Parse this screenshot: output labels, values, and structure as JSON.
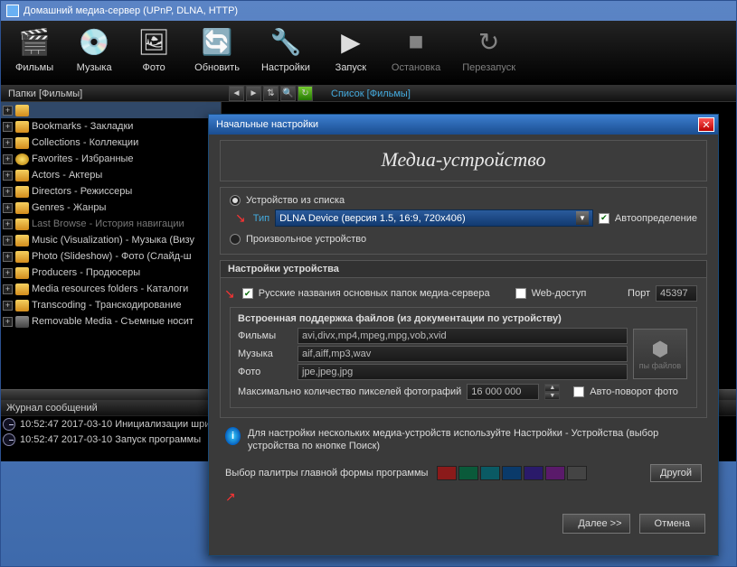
{
  "window": {
    "title": "Домашний медиа-сервер (UPnP, DLNA, HTTP)"
  },
  "toolbar": [
    {
      "label": "Фильмы",
      "glyph": "🎬"
    },
    {
      "label": "Музыка",
      "glyph": "💿"
    },
    {
      "label": "Фото",
      "glyph": "🖼"
    },
    {
      "label": "Обновить",
      "glyph": "🔄"
    },
    {
      "label": "Настройки",
      "glyph": "🔧"
    },
    {
      "label": "Запуск",
      "glyph": "▶"
    },
    {
      "label": "Остановка",
      "glyph": "■"
    },
    {
      "label": "Перезапуск",
      "glyph": "↻"
    }
  ],
  "header": {
    "folders": "Папки [Фильмы]",
    "list": "Список [Фильмы]"
  },
  "tree": [
    {
      "label": "",
      "sel": true
    },
    {
      "label": "Bookmarks - Закладки"
    },
    {
      "label": "Collections - Коллекции"
    },
    {
      "label": "Favorites - Избранные",
      "star": true
    },
    {
      "label": "Actors - Актеры"
    },
    {
      "label": "Directors - Режиссеры"
    },
    {
      "label": "Genres - Жанры"
    },
    {
      "label": "Last Browse - История навигации",
      "dim": true
    },
    {
      "label": "Music (Visualization) - Музыка (Визу"
    },
    {
      "label": "Photo (Slideshow) - Фото (Слайд-ш"
    },
    {
      "label": "Producers - Продюсеры"
    },
    {
      "label": "Media resources folders - Каталоги"
    },
    {
      "label": "Transcoding - Транскодирование"
    },
    {
      "label": "Removable Media - Съемные носит",
      "grey": true
    }
  ],
  "log": {
    "title": "Журнал сообщений",
    "rows": [
      "10:52:47 2017-03-10 Инициализации шри",
      "10:52:47 2017-03-10 Запуск программы"
    ]
  },
  "dlg": {
    "title": "Начальные настройки",
    "heading": "Медиа-устройство",
    "group1": {
      "opt1": "Устройство из списка",
      "typeLabel": "Тип",
      "typeValue": "DLNA Device (версия 1.5, 16:9, 720x406)",
      "autodetect": "Автоопределение",
      "opt2": "Произвольное устройство"
    },
    "group2": {
      "title": "Настройки устройства",
      "ruNames": "Русские названия основных папок медиа-сервера",
      "web": "Web-доступ",
      "portLabel": "Порт",
      "port": "45397",
      "filesup": {
        "title": "Встроенная поддержка файлов (из документации по устройству)",
        "movies": {
          "label": "Фильмы",
          "value": "avi,divx,mp4,mpeg,mpg,vob,xvid"
        },
        "music": {
          "label": "Музыка",
          "value": "aif,aiff,mp3,wav"
        },
        "photo": {
          "label": "Фото",
          "value": "jpe,jpeg,jpg"
        },
        "iconText": "пы файлов"
      },
      "maxpx": "Максимально количество пикселей фотографий",
      "maxpxValue": "16 000 000",
      "autorotate": "Авто-поворот фото"
    },
    "tip": "Для настройки нескольких медиа-устройств используйте Настройки - Устройства (выбор устройства по кнопке Поиск)",
    "palette": {
      "label": "Выбор палитры главной формы программы",
      "swatches": [
        "#8b1a1a",
        "#0a5a3a",
        "#0a5a64",
        "#0a3a6a",
        "#2a1a6a",
        "#5a1a6a",
        "#444444"
      ],
      "other": "Другой"
    },
    "next": "Далее >>",
    "cancel": "Отмена"
  }
}
